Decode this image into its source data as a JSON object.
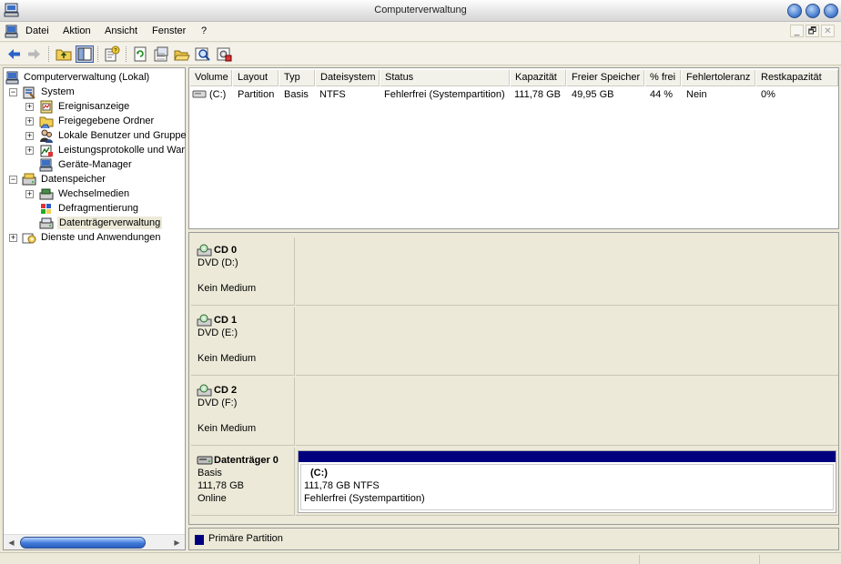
{
  "window": {
    "title": "Computerverwaltung"
  },
  "menu": [
    "Datei",
    "Aktion",
    "Ansicht",
    "Fenster",
    "?"
  ],
  "mdi_controls": [
    "_",
    "🗗",
    "✕"
  ],
  "tree": {
    "root": "Computerverwaltung (Lokal)",
    "system": "System",
    "system_children": [
      "Ereignisanzeige",
      "Freigegebene Ordner",
      "Lokale Benutzer und Gruppe",
      "Leistungsprotokolle und War",
      "Geräte-Manager"
    ],
    "storage": "Datenspeicher",
    "storage_children": [
      "Wechselmedien",
      "Defragmentierung",
      "Datenträgerverwaltung"
    ],
    "services": "Dienste und Anwendungen",
    "selected": "Datenträgerverwaltung"
  },
  "volume_table": {
    "columns": [
      "Volume",
      "Layout",
      "Typ",
      "Dateisystem",
      "Status",
      "Kapazität",
      "Freier Speicher",
      "% frei",
      "Fehlertoleranz",
      "Restkapazität"
    ],
    "rows": [
      [
        "(C:)",
        "Partition",
        "Basis",
        "NTFS",
        "Fehlerfrei (Systempartition)",
        "111,78 GB",
        "49,95 GB",
        "44 %",
        "Nein",
        "0%"
      ]
    ]
  },
  "disks": [
    {
      "name": "CD 0",
      "type": "DVD (D:)",
      "status": "Kein Medium"
    },
    {
      "name": "CD 1",
      "type": "DVD (E:)",
      "status": "Kein Medium"
    },
    {
      "name": "CD 2",
      "type": "DVD (F:)",
      "status": "Kein Medium"
    }
  ],
  "disk0": {
    "name": "Datenträger 0",
    "kind": "Basis",
    "size": "111,78 GB",
    "state": "Online",
    "partition": {
      "label": "(C:)",
      "size_fs": "111,78 GB NTFS",
      "status": "Fehlerfrei (Systempartition)"
    }
  },
  "legend": {
    "label": "Primäre Partition",
    "color": "#00007f"
  },
  "colors": {
    "primary_partition": "#00007f",
    "window_blue": "#3f76cc"
  }
}
